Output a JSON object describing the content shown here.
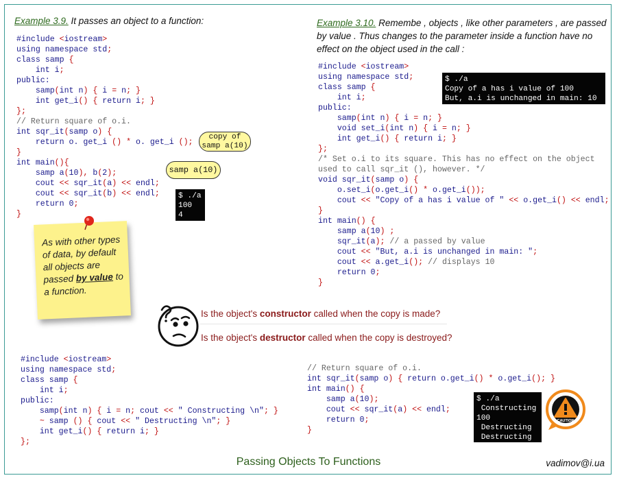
{
  "ex1": {
    "prefix": "Example 3.9.",
    "rest": " It passes an object to a function:"
  },
  "ex2": {
    "line1_prefix": "Example 3.10.",
    "line1_rest": " Remembe , objects , like other parameters , are passed",
    "line2": "by value . Thus changes to the parameter inside a function have no",
    "line3": "effect on the object used in the call :"
  },
  "code1": [
    "#include <iostream>",
    "using namespace std;",
    "class samp {",
    "    int i;",
    "public:",
    "    samp(int n) { i = n; }",
    "    int get_i() { return i; }",
    "};",
    "// Return square of o.i.",
    "int sqr_it(samp o) {",
    "    return o. get_i () * o. get_i ();",
    "}",
    "int main(){",
    "    samp a(10), b(2);",
    "    cout << sqr_it(a) << endl;",
    "    cout << sqr_it(b) << endl;",
    "    return 0;",
    "}"
  ],
  "bubble1": [
    "copy of",
    "samp a(10)"
  ],
  "bubble2": "samp a(10)",
  "term1": [
    "$ ./a",
    "100",
    "4"
  ],
  "note": {
    "text": "As with other types of data, by default all objects are passed",
    "emphasis": "by value",
    "tail": " to a function."
  },
  "code2": [
    "#include <iostream>",
    "using namespace std;",
    "class samp {",
    "    int i;",
    "public:",
    "    samp(int n) { i = n; }",
    "    void set_i(int n) { i = n; }",
    "    int get_i() { return i; }",
    "};",
    "/* Set o.i to its square. This has no effect on the object",
    "used to call sqr_it (), however. */",
    "void sqr_it(samp o) {",
    "    o.set_i(o.get_i() * o.get_i());",
    "    cout << \"Copy of a has i value of \" << o.get_i() << endl;",
    "}",
    "int main() {",
    "    samp a(10) ;",
    "    sqr_it(a); // a passed by value",
    "    cout << \"But, a.i is unchanged in main: \";",
    "    cout << a.get_i(); // displays 10",
    "    return 0;",
    "}"
  ],
  "term2": [
    "$ ./a",
    "Copy of a has i value of 100",
    "But, a.i is unchanged in main: 10"
  ],
  "questions": {
    "q1_pre": "Is the object's ",
    "q1_bold": "constructor",
    "q1_post": " called when the copy is  made?",
    "q2_pre": "Is the object's ",
    "q2_bold": "destructor",
    "q2_post": " called when the copy is destroyed?"
  },
  "code3": [
    "#include <iostream>",
    "using namespace std;",
    "class samp {",
    "    int i;",
    "public:",
    "    samp(int n) { i = n; cout << \" Constructing \\n\"; }",
    "    ~ samp () { cout << \" Destructing \\n\"; }",
    "    int get_i() { return i; }",
    "};"
  ],
  "code4": [
    "// Return square of o.i.",
    "int sqr_it(samp o) { return o.get_i() * o.get_i(); }",
    "int main() {",
    "    samp a(10);",
    "    cout << sqr_it(a) << endl;",
    "    return 0;",
    "}"
  ],
  "term3": [
    "$ ./a",
    " Constructing",
    "100",
    " Destructing",
    " Destructing"
  ],
  "caution_label": "CAUTION",
  "footer": "Passing Objects To Functions",
  "email": "vadimov@i.ua",
  "colors": {
    "keyword": "#1a1a8c",
    "punct": "#c01010",
    "comment": "#666666",
    "note_bg": "#fdf28c",
    "bubble_bg": "#fff8a0",
    "caution": "#f08a1c",
    "footer": "#2d5f1c"
  }
}
